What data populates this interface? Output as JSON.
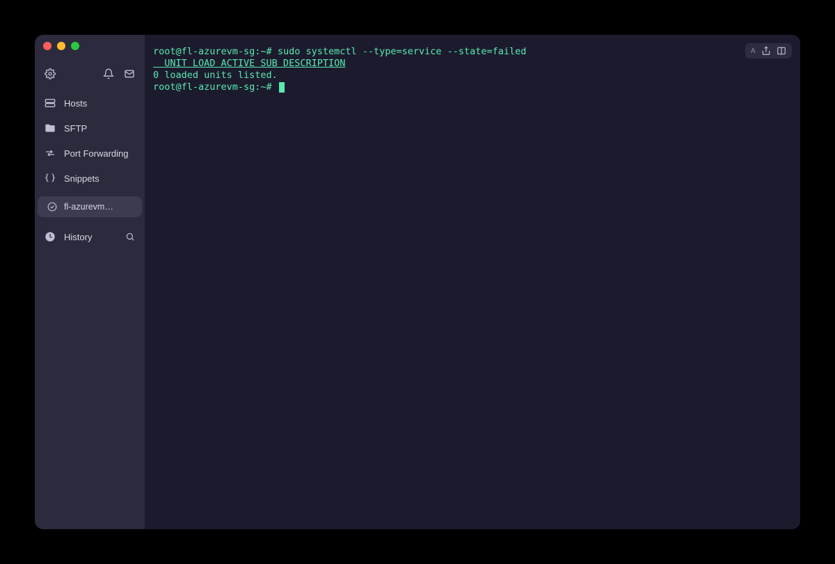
{
  "sidebar": {
    "items": [
      {
        "label": "Hosts"
      },
      {
        "label": "SFTP"
      },
      {
        "label": "Port Forwarding"
      },
      {
        "label": "Snippets"
      }
    ],
    "session": {
      "label": "fl-azurevm…"
    },
    "history": {
      "label": "History"
    }
  },
  "topright": {
    "badge": "A"
  },
  "terminal": {
    "prompt1": "root@fl-azurevm-sg:~# ",
    "command1": "sudo systemctl --type=service --state=failed",
    "header": "  UNIT LOAD ACTIVE SUB DESCRIPTION",
    "status": "0 loaded units listed.",
    "prompt2": "root@fl-azurevm-sg:~# "
  },
  "colors": {
    "accent": "#5aeab0",
    "sidebar_bg": "#2c2b3e",
    "terminal_bg": "#1c1b2e"
  }
}
